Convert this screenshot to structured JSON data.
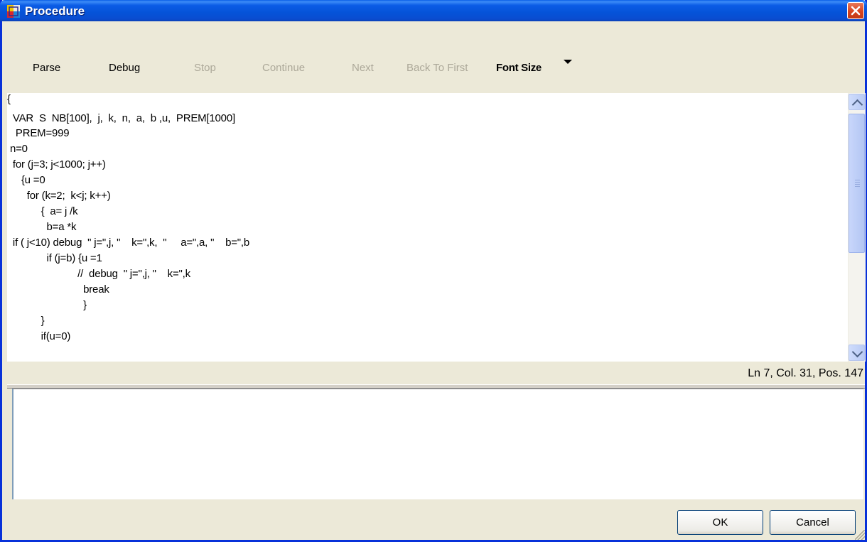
{
  "window": {
    "title": "Procedure",
    "icon": "procedure-app-icon"
  },
  "toolbar": {
    "parse": "Parse",
    "debug": "Debug",
    "stop": "Stop",
    "continue": "Continue",
    "next": "Next",
    "back_to_first": "Back To First",
    "font_size": "Font Size"
  },
  "editor": {
    "lines": [
      "{",
      "  VAR  S  NB[100],  j,  k,  n,  a,  b ,u,  PREM[1000]",
      "   PREM=999",
      " n=0",
      "  for (j=3; j<1000; j++)",
      "     {u =0",
      "       for (k=2;  k<j; k++)",
      "            {  a= j /k",
      "              b=a *k",
      "  if ( j<10) debug  \" j=\",j, \"    k=\",k,  \"     a=\",a, \"    b=\",b",
      "              if (j=b) {u =1",
      "                         //  debug  \" j=\",j, \"    k=\",k",
      "                           break",
      "                           }",
      "            }",
      "            if(u=0)"
    ]
  },
  "status": {
    "position": "Ln 7, Col. 31, Pos. 147"
  },
  "buttons": {
    "ok": "OK",
    "cancel": "Cancel"
  }
}
